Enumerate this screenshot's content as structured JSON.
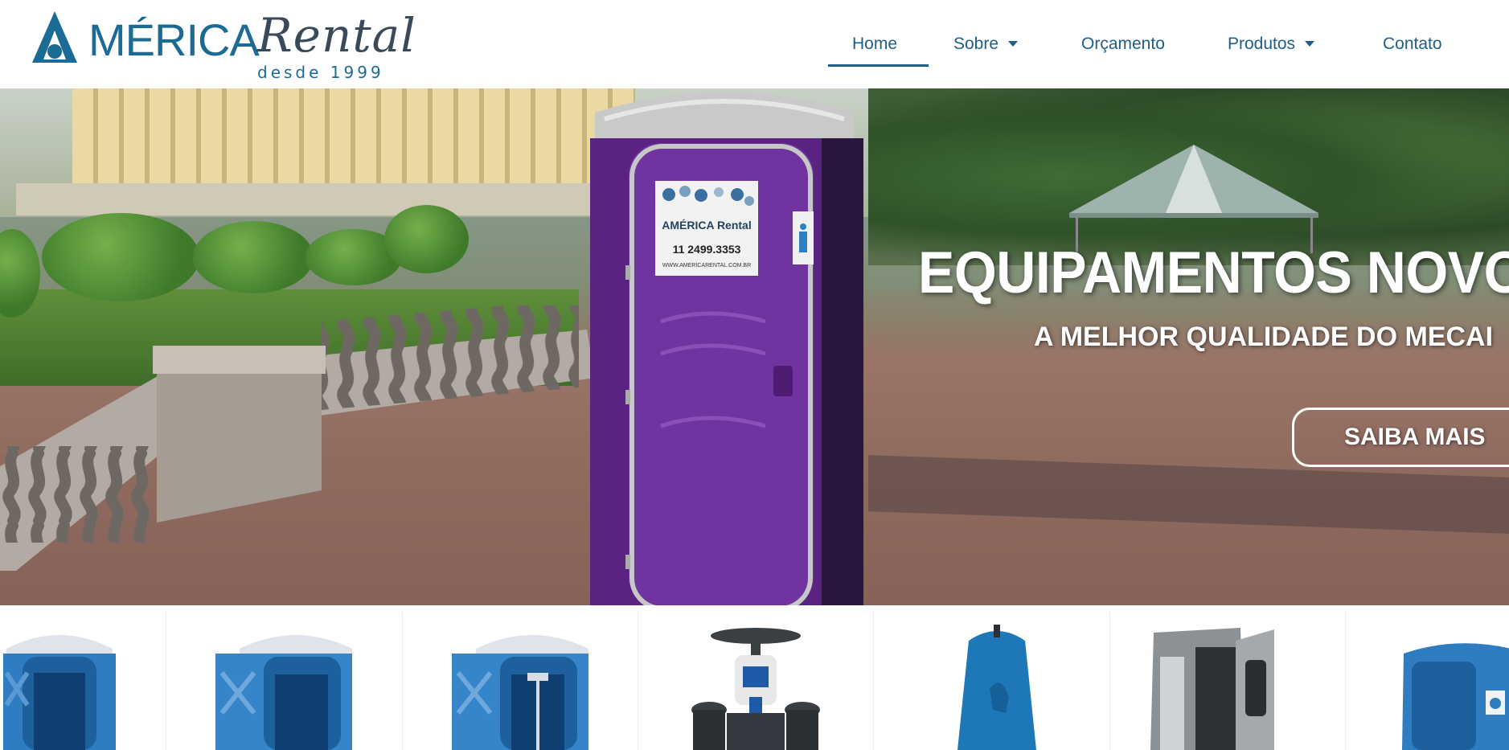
{
  "brand": {
    "logo_word": "MÉRICA",
    "logo_script": "Rental",
    "logo_tagline": "desde 1999",
    "primary_color": "#1d5f86",
    "logo_color": "#1b6b95"
  },
  "nav": {
    "items": [
      {
        "label": "Home",
        "active": true,
        "has_dropdown": false
      },
      {
        "label": "Sobre",
        "active": false,
        "has_dropdown": true
      },
      {
        "label": "Orçamento",
        "active": false,
        "has_dropdown": false
      },
      {
        "label": "Produtos",
        "active": false,
        "has_dropdown": true
      },
      {
        "label": "Contato",
        "active": false,
        "has_dropdown": false
      }
    ]
  },
  "hero": {
    "title": "EQUIPAMENTOS NOVO",
    "subtitle": "A MELHOR QUALIDADE DO MECAI",
    "cta_label": "SAIBA MAIS",
    "toilet": {
      "color": "#6c2f97",
      "sticker_brand": "AMÉRICA Rental",
      "sticker_phone": "11 2499.3353",
      "sticker_url": "WWW.AMERICARENTAL.COM.BR"
    }
  },
  "products": [
    {
      "icon": "blue-portable-toilet-icon"
    },
    {
      "icon": "blue-portable-toilet-icon"
    },
    {
      "icon": "blue-portable-toilet-with-sink-icon"
    },
    {
      "icon": "handwash-station-icon"
    },
    {
      "icon": "urinal-station-icon"
    },
    {
      "icon": "grey-cabin-icon"
    },
    {
      "icon": "accessible-toilet-icon"
    }
  ]
}
